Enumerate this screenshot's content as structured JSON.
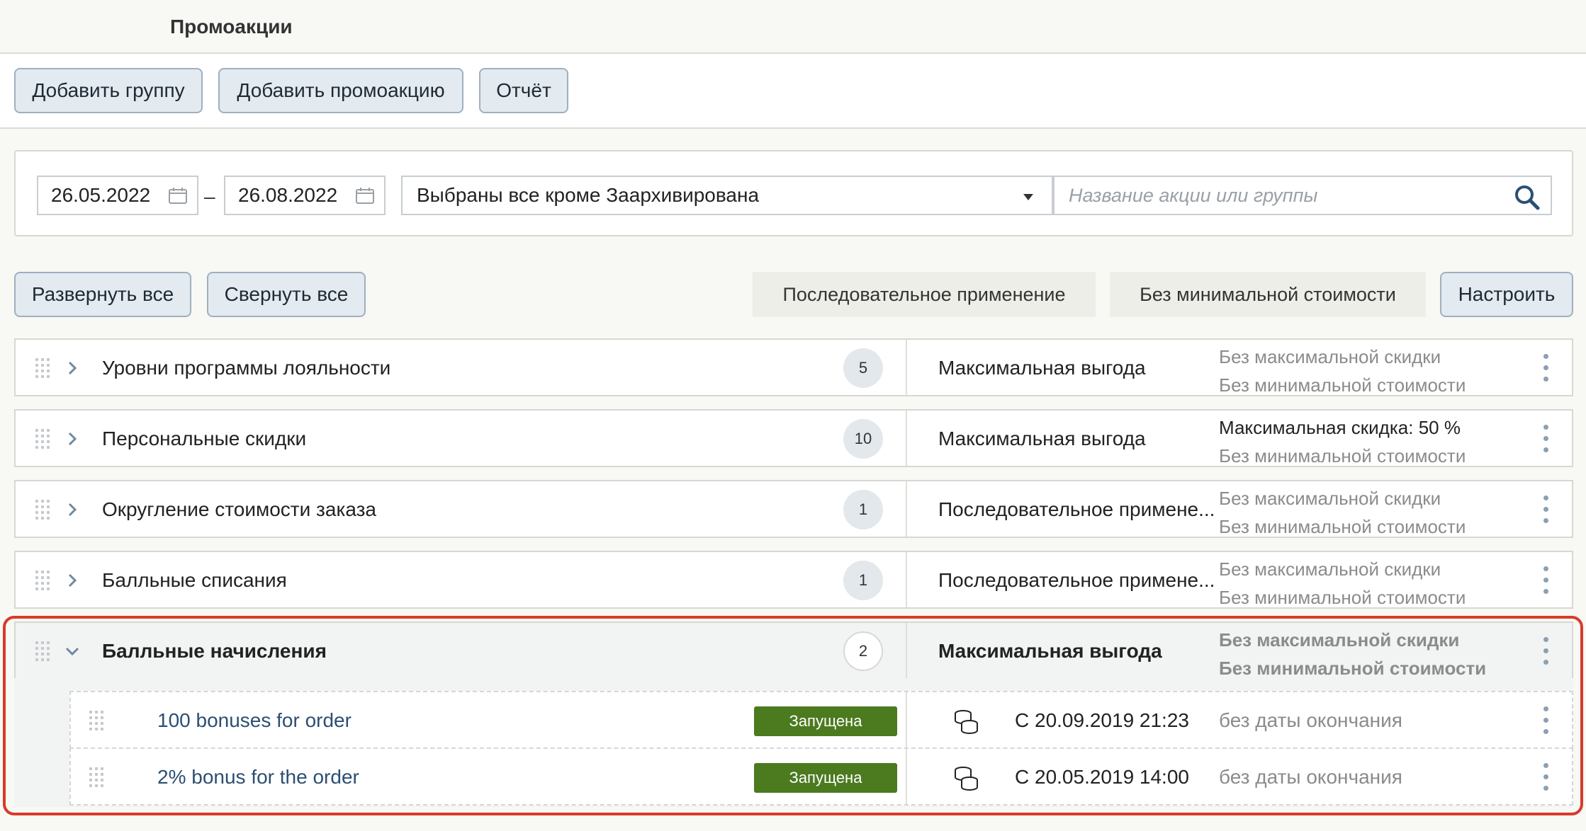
{
  "page": {
    "title": "Промоакции"
  },
  "toolbar": {
    "add_group": "Добавить группу",
    "add_promo": "Добавить промоакцию",
    "report": "Отчёт"
  },
  "filters": {
    "date_from": "26.05.2022",
    "date_to": "26.08.2022",
    "separator": "–",
    "status_select": "Выбраны все кроме Заархивирована",
    "search_placeholder": "Название акции или группы"
  },
  "actions": {
    "expand_all": "Развернуть все",
    "collapse_all": "Свернуть все",
    "mode": "Последовательное применение",
    "min_cost": "Без минимальной стоимости",
    "configure": "Настроить"
  },
  "groups": [
    {
      "name": "Уровни программы лояльности",
      "count": "5",
      "strategy": "Максимальная выгода",
      "limit1": "Без максимальной скидки",
      "limit2": "Без минимальной стоимости"
    },
    {
      "name": "Персональные скидки",
      "count": "10",
      "strategy": "Максимальная выгода",
      "limit1": "Максимальная скидка: 50 %",
      "limit2": "Без минимальной стоимости"
    },
    {
      "name": "Округление стоимости заказа",
      "count": "1",
      "strategy": "Последовательное примене...",
      "limit1": "Без максимальной скидки",
      "limit2": "Без минимальной стоимости"
    },
    {
      "name": "Балльные списания",
      "count": "1",
      "strategy": "Последовательное примене...",
      "limit1": "Без максимальной скидки",
      "limit2": "Без минимальной стоимости"
    },
    {
      "name": "Балльные начисления",
      "count": "2",
      "strategy": "Максимальная выгода",
      "limit1": "Без максимальной скидки",
      "limit2": "Без минимальной стоимости",
      "expanded": true
    }
  ],
  "promos": [
    {
      "name": "100 bonuses for order",
      "status": "Запущена",
      "start": "С 20.09.2019 21:23",
      "end": "без даты окончания"
    },
    {
      "name": "2% bonus for the order",
      "status": "Запущена",
      "start": "С 20.05.2019 14:00",
      "end": "без даты окончания"
    }
  ],
  "colors": {
    "accent": "#2b4f73",
    "status_running": "#4c7a1f",
    "highlight": "#d93a2b"
  }
}
